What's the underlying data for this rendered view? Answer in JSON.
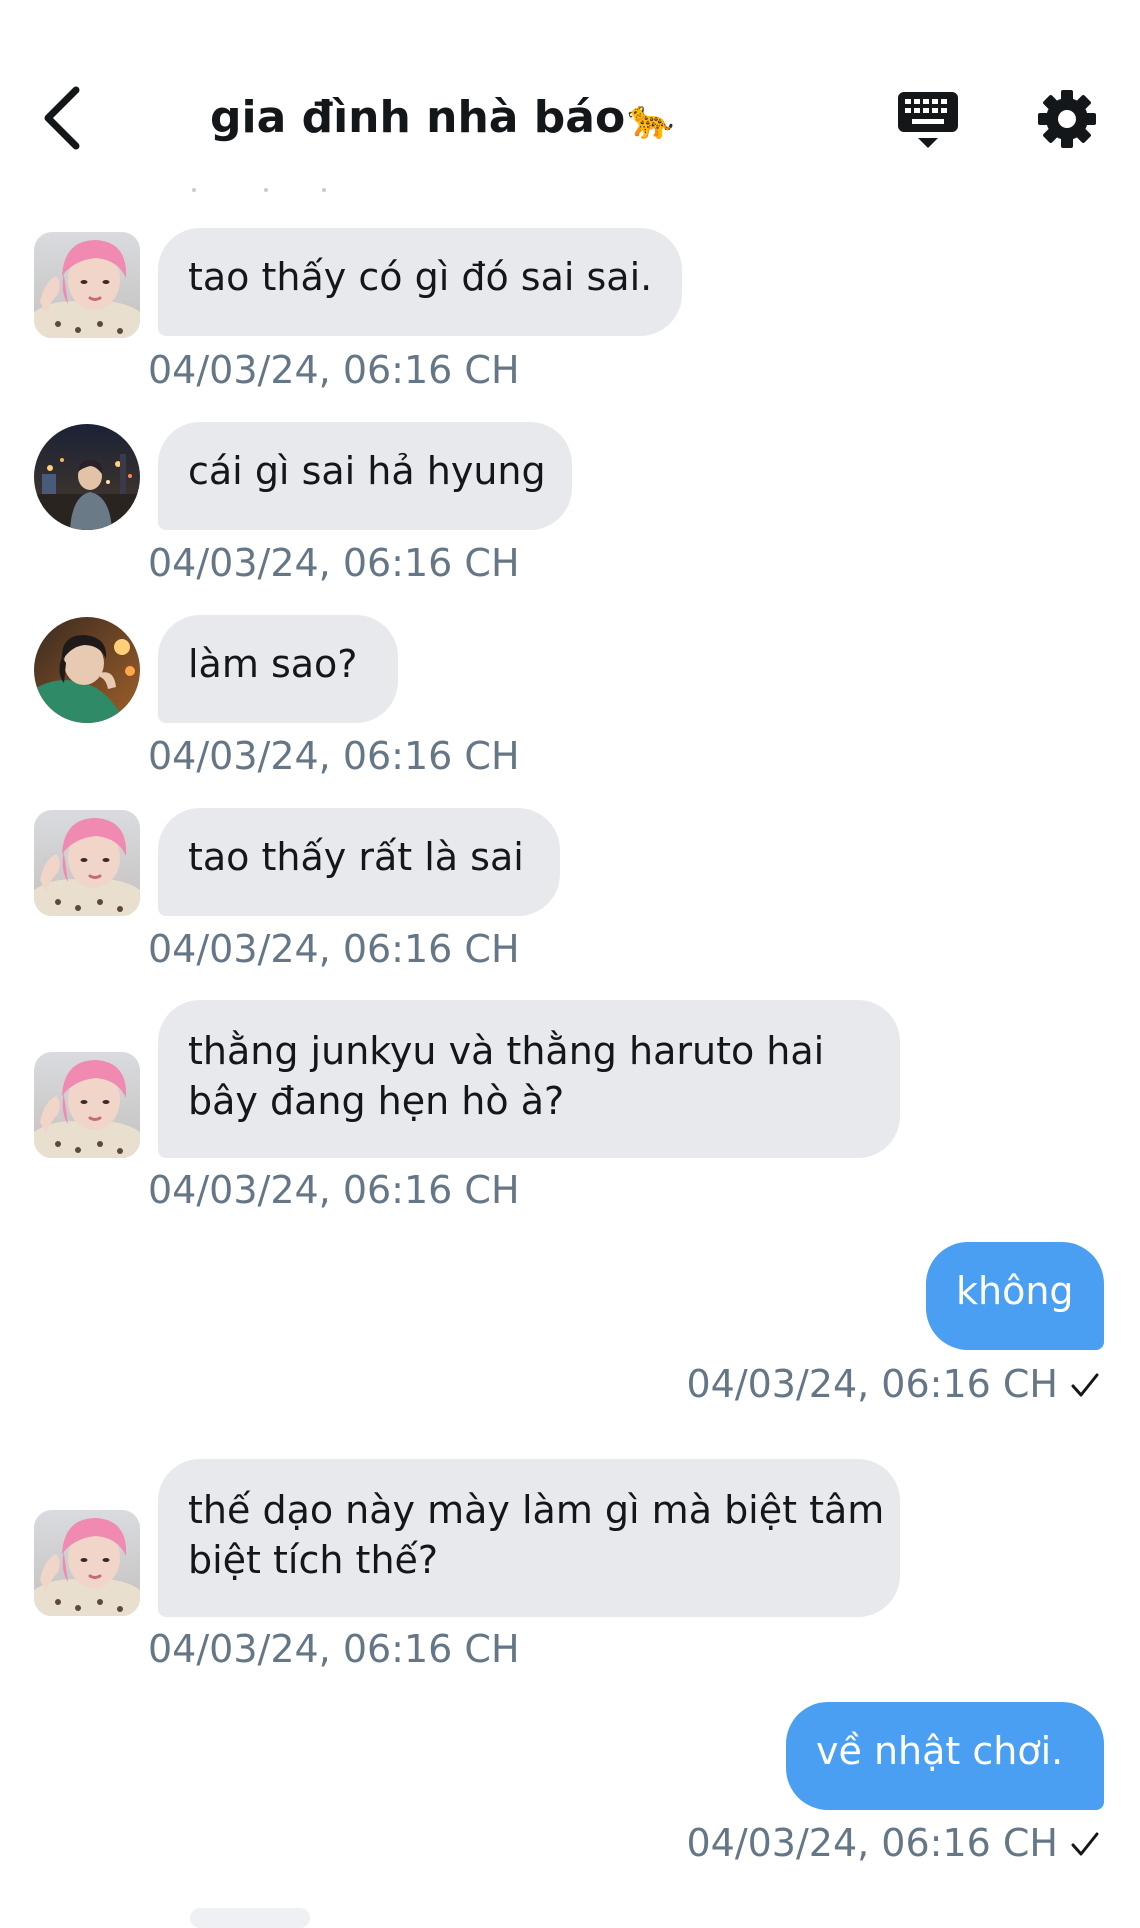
{
  "header": {
    "title": "gia đình nhà báo",
    "title_emoji": "🐆",
    "back_icon": "chevron-left-icon",
    "keyboard_icon": "keyboard-icon",
    "settings_icon": "gear-icon"
  },
  "colors": {
    "incoming_bubble": "#e7e9ed",
    "outgoing_bubble": "#4a9ff2",
    "timestamp": "#657786",
    "text": "#14171a"
  },
  "messages": [
    {
      "direction": "incoming",
      "avatar": "pink-hair-avatar",
      "text": "tao thấy có gì đó sai sai.",
      "timestamp": "04/03/24, 06:16 CH"
    },
    {
      "direction": "incoming",
      "avatar": "night-street-avatar",
      "text": "cái gì sai hả hyung",
      "timestamp": "04/03/24, 06:16 CH"
    },
    {
      "direction": "incoming",
      "avatar": "green-shirt-avatar",
      "text": "làm sao?",
      "timestamp": "04/03/24, 06:16 CH"
    },
    {
      "direction": "incoming",
      "avatar": "pink-hair-avatar",
      "text": "tao thấy rất là sai",
      "timestamp": "04/03/24, 06:16 CH"
    },
    {
      "direction": "incoming",
      "avatar": "pink-hair-avatar",
      "text_line1": "thằng junkyu và thằng haruto hai",
      "text_line2": "bây đang hẹn hò à?",
      "timestamp": "04/03/24, 06:16 CH"
    },
    {
      "direction": "outgoing",
      "text": "không",
      "timestamp": "04/03/24, 06:16 CH",
      "status_icon": "checkmark-icon"
    },
    {
      "direction": "incoming",
      "avatar": "pink-hair-avatar",
      "text_line1": "thế dạo này mày làm gì mà biệt tâm",
      "text_line2": "biệt tích thế?",
      "timestamp": "04/03/24, 06:16 CH"
    },
    {
      "direction": "outgoing",
      "text": "về nhật chơi.",
      "timestamp": "04/03/24, 06:16 CH",
      "status_icon": "checkmark-icon"
    }
  ]
}
